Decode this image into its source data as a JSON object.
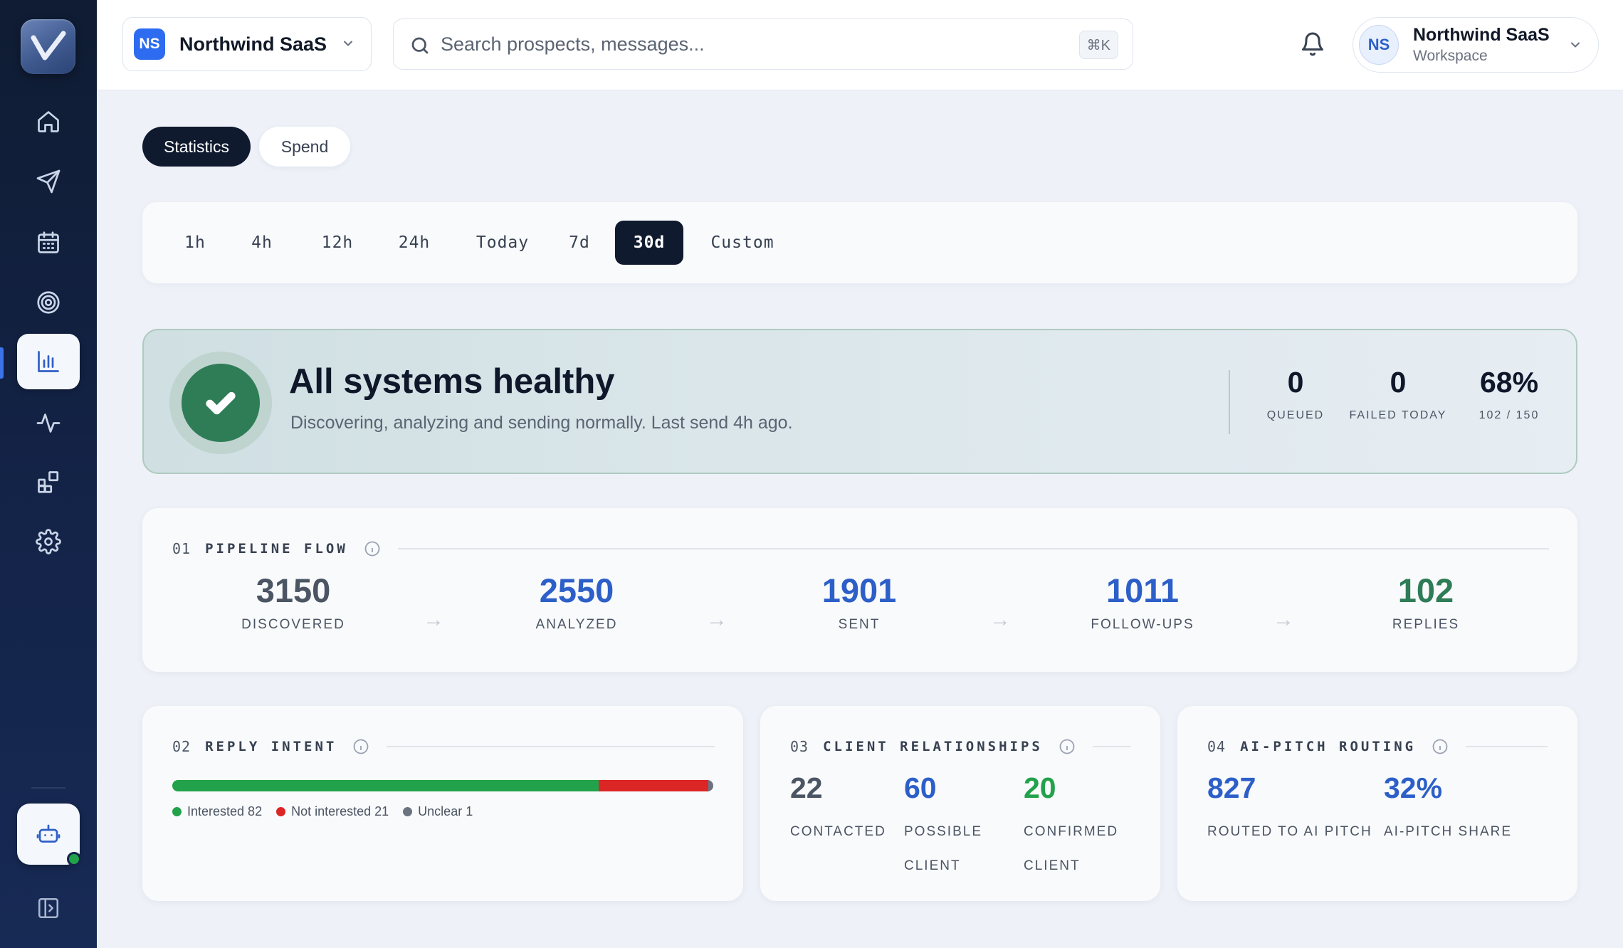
{
  "topbar": {
    "workspace": {
      "badge": "NS",
      "name": "Northwind SaaS"
    },
    "search": {
      "placeholder": "Search prospects, messages...",
      "shortcut": "⌘K"
    },
    "user": {
      "initials": "NS",
      "name": "Northwind SaaS",
      "role": "Workspace"
    }
  },
  "sidebar": {
    "items": [
      {
        "icon": "home-icon"
      },
      {
        "icon": "send-icon"
      },
      {
        "icon": "calendar-icon"
      },
      {
        "icon": "target-icon"
      },
      {
        "icon": "bar-chart-icon",
        "active": true
      },
      {
        "icon": "activity-icon"
      },
      {
        "icon": "widgets-icon"
      },
      {
        "icon": "gear-icon"
      }
    ],
    "bot_status": "online",
    "accent": "#3b73e8"
  },
  "tabs": [
    {
      "label": "Statistics",
      "active": true
    },
    {
      "label": "Spend",
      "active": false
    }
  ],
  "time_range": {
    "options": [
      "1h",
      "4h",
      "12h",
      "24h",
      "Today",
      "7d",
      "30d",
      "Custom"
    ],
    "selected": "30d"
  },
  "health": {
    "title": "All systems healthy",
    "subtitle": "Discovering, analyzing and sending normally. Last send 4h ago.",
    "stats": [
      {
        "value": "0",
        "label": "QUEUED"
      },
      {
        "value": "0",
        "label": "FAILED TODAY"
      },
      {
        "value": "68%",
        "label": "102 / 150"
      }
    ],
    "status_color": "#2e7d57"
  },
  "pipeline": {
    "num": "01",
    "title": "PIPELINE FLOW",
    "steps": [
      {
        "value": "3150",
        "label": "DISCOVERED",
        "color": "#4b5563"
      },
      {
        "value": "2550",
        "label": "ANALYZED",
        "color": "#2d5fc8"
      },
      {
        "value": "1901",
        "label": "SENT",
        "color": "#2d5fc8"
      },
      {
        "value": "1011",
        "label": "FOLLOW-UPS",
        "color": "#2d5fc8"
      },
      {
        "value": "102",
        "label": "REPLIES",
        "color": "#2e7d57"
      }
    ],
    "arrow": "→"
  },
  "reply_intent": {
    "num": "02",
    "title": "REPLY INTENT",
    "segments": [
      {
        "name": "Interested",
        "count": 82,
        "color": "#22a24a",
        "legend": "Interested 82"
      },
      {
        "name": "Not interested",
        "count": 21,
        "color": "#dc2626",
        "legend": "Not interested 21"
      },
      {
        "name": "Unclear",
        "count": 1,
        "color": "#6b7280",
        "legend": "Unclear 1"
      }
    ]
  },
  "client_relationships": {
    "num": "03",
    "title": "CLIENT RELATIONSHIPS",
    "stats": [
      {
        "value": "22",
        "label_1": "CONTACTED",
        "label_2": "",
        "color": "#4b5563"
      },
      {
        "value": "60",
        "label_1": "POSSIBLE",
        "label_2": "CLIENT",
        "color": "#2d5fc8"
      },
      {
        "value": "20",
        "label_1": "CONFIRMED",
        "label_2": "CLIENT",
        "color": "#22a24a"
      }
    ]
  },
  "ai_pitch": {
    "num": "04",
    "title": "AI-PITCH ROUTING",
    "stats": [
      {
        "value": "827",
        "label": "ROUTED TO AI PITCH",
        "color": "#2d5fc8"
      },
      {
        "value": "32%",
        "label": "AI-PITCH SHARE",
        "color": "#2d5fc8"
      }
    ]
  }
}
